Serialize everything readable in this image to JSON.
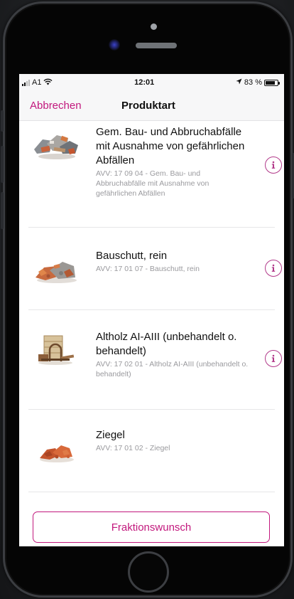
{
  "status": {
    "carrier": "A1",
    "time": "12:01",
    "battery": "83 %",
    "battery_level": 0.83
  },
  "nav": {
    "cancel_label": "Abbrechen",
    "title": "Produktart"
  },
  "items": [
    {
      "title": "Gem. Bau- und Abbruchabfälle mit Ausnahme von gefährlichen Abfällen",
      "subtitle": "AVV: 17 09 04 - Gem. Bau- und Abbruchabfälle mit Ausnahme von gefährlichen Abfällen",
      "image": "mixed-construction-waste",
      "has_info": true
    },
    {
      "title": "Bauschutt, rein",
      "subtitle": "AVV: 17 01 07 - Bauschutt, rein",
      "image": "rubble",
      "has_info": true
    },
    {
      "title": "Altholz AI-AIII (unbehandelt o. behandelt)",
      "subtitle": "AVV: 17 02 01 - Altholz AI-AIII (unbehandelt o. behandelt)",
      "image": "waste-wood",
      "has_info": true
    },
    {
      "title": "Ziegel",
      "subtitle": "AVV: 17 01 02 - Ziegel",
      "image": "bricks",
      "has_info": false
    }
  ],
  "footer": {
    "button_label": "Fraktionswunsch"
  },
  "colors": {
    "accent": "#c2187d",
    "info_icon": "#b23a8a",
    "subtitle": "#9a9a9e"
  }
}
